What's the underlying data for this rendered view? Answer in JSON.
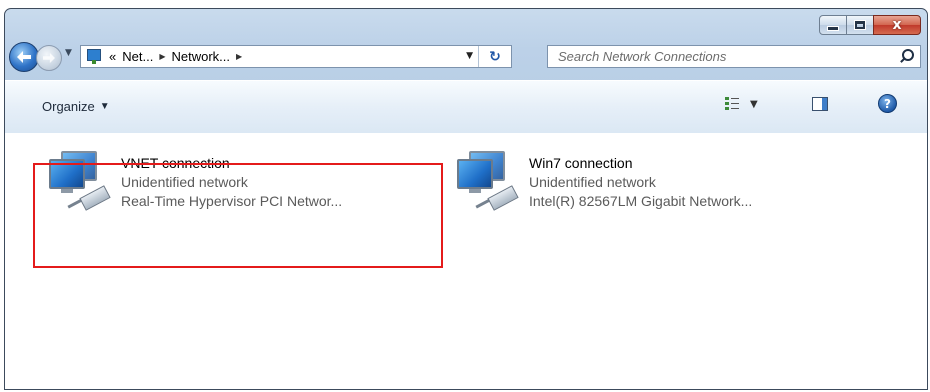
{
  "window": {
    "caption_buttons": {
      "minimize": "minimize",
      "maximize": "maximize",
      "close": "x"
    }
  },
  "nav": {
    "breadcrumbs": [
      "Net...",
      "Network..."
    ],
    "breadcrumb_overflow": "«",
    "search_placeholder": "Search Network Connections"
  },
  "toolbar": {
    "organize_label": "Organize",
    "help_glyph": "?"
  },
  "connections": [
    {
      "name": "VNET connection",
      "status": "Unidentified network",
      "adapter": "Real-Time Hypervisor PCI Networ...",
      "highlighted": true,
      "highlight_color": "#e41b1b"
    },
    {
      "name": "Win7 connection",
      "status": "Unidentified network",
      "adapter": "Intel(R) 82567LM Gigabit Network...",
      "highlighted": false
    }
  ],
  "colors": {
    "title_bar": "#bcd1e8",
    "close_button": "#c0392b",
    "secondary_text": "#5a5a5a"
  }
}
